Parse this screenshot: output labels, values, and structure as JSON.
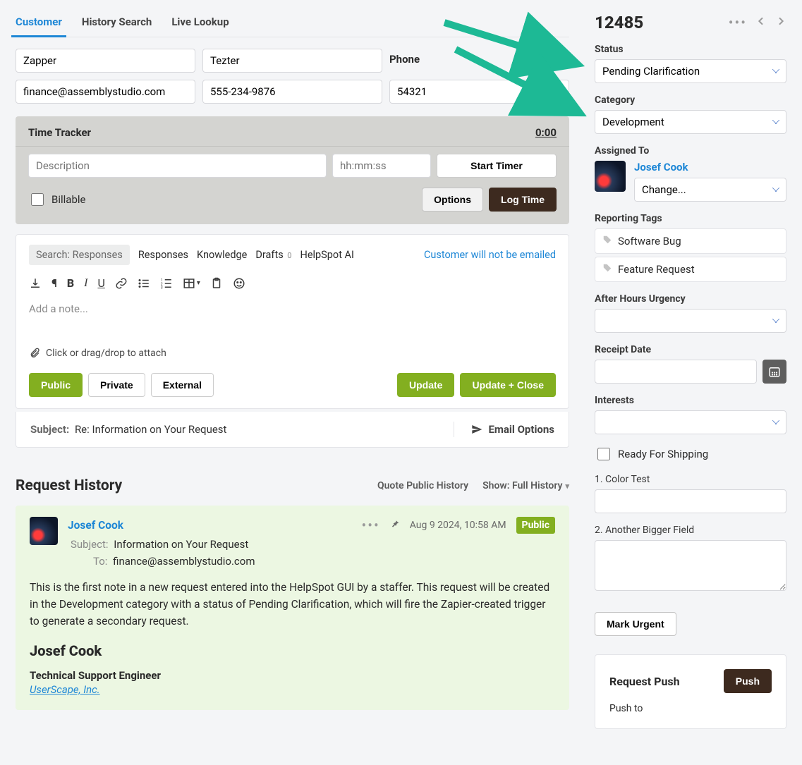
{
  "tabs": {
    "customer": "Customer",
    "history": "History Search",
    "live": "Live Lookup"
  },
  "customer": {
    "first": "Zapper",
    "last": "Tezter",
    "phoneLabel": "Phone",
    "email": "finance@assemblystudio.com",
    "phone": "555-234-9876",
    "id": "54321"
  },
  "timeTracker": {
    "title": "Time Tracker",
    "elapsed": "0:00",
    "descPh": "Description",
    "hmsPh": "hh:mm:ss",
    "start": "Start Timer",
    "billable": "Billable",
    "options": "Options",
    "log": "Log Time"
  },
  "note": {
    "tabSearch": "Search: Responses",
    "tabResponses": "Responses",
    "tabKnowledge": "Knowledge",
    "tabDrafts": "Drafts",
    "draftsCount": "0",
    "tabAI": "HelpSpot AI",
    "noEmail": "Customer will not be emailed",
    "placeholder": "Add a note...",
    "attach": "Click or drag/drop to attach",
    "public": "Public",
    "private": "Private",
    "external": "External",
    "update": "Update",
    "updateClose": "Update + Close"
  },
  "subject": {
    "label": "Subject:",
    "text": "Re: Information on Your Request",
    "emailOptions": "Email Options"
  },
  "history": {
    "title": "Request History",
    "quote": "Quote Public History",
    "show": "Show: Full History",
    "card": {
      "author": "Josef Cook",
      "date": "Aug 9 2024, 10:58 AM",
      "badge": "Public",
      "subjectLabel": "Subject:",
      "subject": "Information on Your Request",
      "toLabel": "To:",
      "to": "finance@assemblystudio.com",
      "body": "This is the first note in a new request entered into the HelpSpot GUI by a staffer. This request will be created in the Development category with a status of Pending Clarification, which will fire the Zapier-created trigger to generate a secondary request.",
      "sigName": "Josef Cook",
      "sigTitle": "Technical Support Engineer",
      "sigLink": "UserScape, Inc."
    }
  },
  "sidebar": {
    "reqId": "12485",
    "statusLabel": "Status",
    "status": "Pending Clarification",
    "categoryLabel": "Category",
    "category": "Development",
    "assignedLabel": "Assigned To",
    "assignedName": "Josef Cook",
    "change": "Change...",
    "reportingLabel": "Reporting Tags",
    "tag1": "Software Bug",
    "tag2": "Feature Request",
    "urgencyLabel": "After Hours Urgency",
    "receiptLabel": "Receipt Date",
    "interestsLabel": "Interests",
    "readyShip": "Ready For Shipping",
    "colorTestLabel": "1. Color Test",
    "biggerLabel": "2. Another Bigger Field",
    "markUrgent": "Mark Urgent",
    "requestPush": "Request Push",
    "push": "Push",
    "pushTo": "Push to"
  }
}
